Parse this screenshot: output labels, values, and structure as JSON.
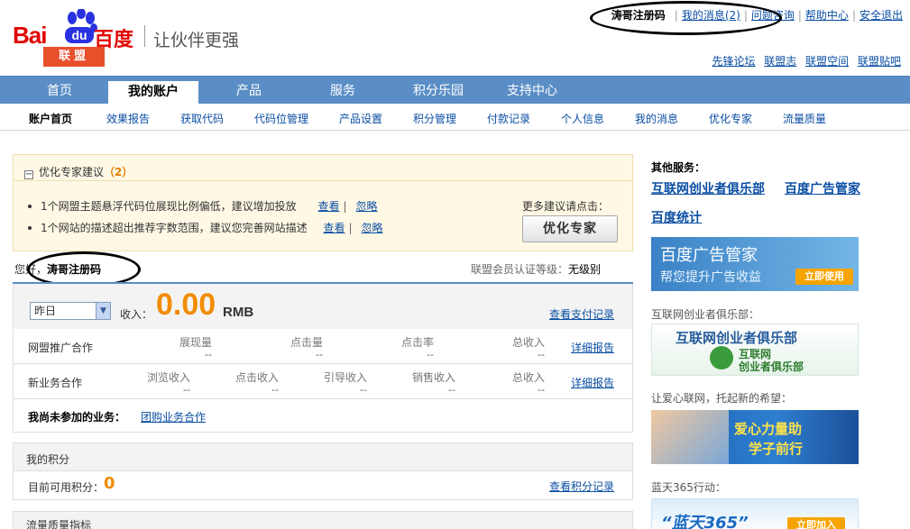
{
  "header": {
    "logo_bai": "Bai",
    "logo_du": "du",
    "logo_cn": "百度",
    "logo_lm": "联盟",
    "slogan": "让伙伴更强",
    "username": "涛哥注册码",
    "top_links": {
      "messages": "我的消息(2)",
      "consult": "问题咨询",
      "help": "帮助中心",
      "logout": "安全退出"
    },
    "sub_links": [
      "先锋论坛",
      "联盟志",
      "联盟空间",
      "联盟贴吧"
    ]
  },
  "nav": {
    "items": [
      "首页",
      "我的账户",
      "产品",
      "服务",
      "积分乐园",
      "支持中心"
    ],
    "active_index": 1
  },
  "subnav": {
    "items": [
      "账户首页",
      "效果报告",
      "获取代码",
      "代码位管理",
      "产品设置",
      "积分管理",
      "付款记录",
      "个人信息",
      "我的消息",
      "优化专家",
      "流量质量"
    ],
    "active_index": 0
  },
  "advice": {
    "title": "优化专家建议",
    "count": "（2）",
    "tips": [
      {
        "text": "1个网盟主题悬浮代码位展现比例偏低，建议增加投放",
        "view": "查看",
        "ignore": "忽略"
      },
      {
        "text": "1个网站的描述超出推荐字数范围，建议您完善网站描述",
        "view": "查看",
        "ignore": "忽略"
      }
    ],
    "more_text": "更多建议请点击：",
    "button": "优化专家"
  },
  "greeting": {
    "prefix": "您好，",
    "name": "涛哥注册码",
    "level_label": "联盟会员认证等级：",
    "level_value": "无级别"
  },
  "income": {
    "period": "昨日",
    "label": "收入：",
    "value": "0.00",
    "unit": "RMB",
    "pay_link": "查看支付记录"
  },
  "coop": {
    "rows": [
      {
        "name": "网盟推广合作",
        "cols": [
          {
            "label": "展现量",
            "value": "--"
          },
          {
            "label": "点击量",
            "value": "--"
          },
          {
            "label": "点击率",
            "value": "--"
          },
          {
            "label": "总收入",
            "value": "--"
          }
        ],
        "link": "详细报告"
      },
      {
        "name": "新业务合作",
        "cols": [
          {
            "label": "浏览收入",
            "value": "--"
          },
          {
            "label": "点击收入",
            "value": "--"
          },
          {
            "label": "引导收入",
            "value": "--"
          },
          {
            "label": "销售收入",
            "value": "--"
          },
          {
            "label": "总收入",
            "value": "--"
          }
        ],
        "link": "详细报告"
      }
    ],
    "not_joined_label": "我尚未参加的业务：",
    "not_joined_link": "团购业务合作"
  },
  "points": {
    "title": "我的积分",
    "label": "目前可用积分：",
    "value": "0",
    "link": "查看积分记录"
  },
  "quality": {
    "title": "流量质量指标"
  },
  "sidebar": {
    "other_title": "其他服务：",
    "services": [
      "互联网创业者俱乐部",
      "百度广告管家",
      "百度统计"
    ],
    "banner1": {
      "title": "百度广告管家",
      "subtitle": "帮您提升广告收益",
      "button": "立即使用"
    },
    "caption2": "互联网创业者俱乐部：",
    "banner2": {
      "title": "互联网创业者俱乐部",
      "line1": "互联网",
      "line2": "创业者俱乐部"
    },
    "caption3": "让爱心联网，托起新的希望：",
    "banner3": {
      "line1": "爱心力量助",
      "line2": "学子前行"
    },
    "caption4": "蓝天365行动：",
    "banner4": {
      "title": "“蓝天365”",
      "button": "立即加入"
    }
  }
}
